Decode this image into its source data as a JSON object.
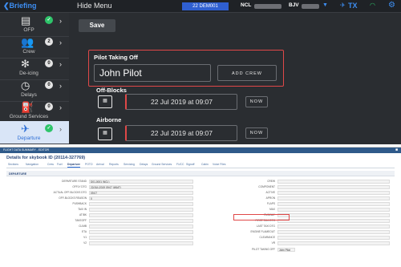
{
  "topbar": {
    "back_label": "Briefing",
    "hide_menu_label": "Hide Menu",
    "flight_id": "22 DEM001",
    "origin": "NCL",
    "destination": "BJV",
    "status_label": "TX",
    "colors": {
      "accent": "#3d8ef2",
      "flight_badge": "#2f5fd0",
      "ok": "#2ec46a"
    }
  },
  "sidebar": {
    "items": [
      {
        "label": "OFP",
        "badge": "✓",
        "icon": "document-icon"
      },
      {
        "label": "Crew",
        "badge": "2",
        "icon": "crew-icon"
      },
      {
        "label": "De-icing",
        "badge": "0",
        "icon": "snowflake-icon"
      },
      {
        "label": "Delays",
        "badge": "0",
        "icon": "clock-icon"
      },
      {
        "label": "Ground Services",
        "badge": "0",
        "icon": "fuel-icon"
      },
      {
        "label": "Departure",
        "badge": "✓",
        "icon": "plane-icon"
      }
    ]
  },
  "main": {
    "save_label": "Save",
    "pilot_title": "Pilot Taking Off",
    "pilot_name": "John Pilot",
    "add_crew_label": "ADD CREW",
    "offblocks_title": "Off-Blocks",
    "offblocks_value": "22 Jul 2019 at 09:07",
    "airborne_title": "Airborne",
    "airborne_value": "22 Jul 2019 at 09:07",
    "now_label": "NOW"
  },
  "web": {
    "window_title": "FLIGHT DATA SUMMARY - EDITOR",
    "details_title": "Details for skybook ID (20114-327769)",
    "tabs": [
      "Sections",
      "Navigation",
      "Crew",
      "Fuel",
      "Departure",
      "POTO",
      "Arrival",
      "Reports",
      "Servicing",
      "Delays",
      "Ground Services",
      "FUCC",
      "Signoff",
      "Cabin",
      "Voice Files"
    ],
    "active_tab": "Departure",
    "section_title": "DEPARTURE",
    "left_rows": [
      {
        "label": "DEPARTURE STAND",
        "value": "D01-0001 (NCL)"
      },
      {
        "label": "OFFLY DTG",
        "value": "22/JUL/2019 09:07 (WAIT)"
      },
      {
        "label": "ACTUAL OFF-BLOCKS DTG",
        "value": "09:07"
      },
      {
        "label": "OFF-BLOCKS REASON",
        "value": "0"
      },
      {
        "label": "PUSHBACK",
        "value": ""
      },
      {
        "label": "TAXI IN",
        "value": ""
      },
      {
        "label": "AT/BK",
        "value": ""
      },
      {
        "label": "TAKEOFF",
        "value": ""
      },
      {
        "label": "CLIMB",
        "value": ""
      },
      {
        "label": "ETA",
        "value": ""
      },
      {
        "label": "V1",
        "value": ""
      },
      {
        "label": "V2",
        "value": ""
      }
    ],
    "right_rows": [
      {
        "label": "CREW",
        "value": ""
      },
      {
        "label": "COMPONENT",
        "value": ""
      },
      {
        "label": "ACTIVE",
        "value": ""
      },
      {
        "label": "APRON",
        "value": ""
      },
      {
        "label": "FLAPS",
        "value": ""
      },
      {
        "label": "MAX",
        "value": ""
      },
      {
        "label": "RUNWAY",
        "value": ""
      },
      {
        "label": "FIRST TAXI DTG",
        "value": ""
      },
      {
        "label": "LAST TAXI DTG",
        "value": ""
      },
      {
        "label": "ENGINE FLAMEOUT",
        "value": ""
      },
      {
        "label": "CLEARANCE",
        "value": ""
      },
      {
        "label": "VR",
        "value": ""
      },
      {
        "label": "PILOT TAKING OFF",
        "value": "John Pilot"
      }
    ]
  }
}
